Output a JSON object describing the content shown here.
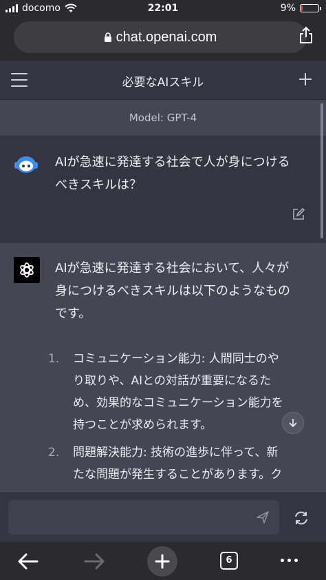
{
  "status_bar": {
    "carrier": "docomo",
    "time": "22:01",
    "battery_text": "9%",
    "battery_level": 0.09
  },
  "browser": {
    "url": "chat.openai.com"
  },
  "chat_header": {
    "title": "必要なAIスキル"
  },
  "model_label": "Model: GPT-4",
  "user_message": {
    "line1": "AIが急速に発達する社会で人が身につける",
    "line2": "べきスキルは？"
  },
  "assistant_message": {
    "intro_lines": [
      "AIが急速に発達する社会において、人々が",
      "身につけるべきスキルは以下のようなもの",
      "です。"
    ],
    "items": [
      {
        "number": "1.",
        "lines": [
          "コミュニケーション能力: 人間同士のや",
          "り取りや、AIとの対話が重要になるた",
          "め、効果的なコミュニケーション能力を",
          "持つことが求められます。"
        ]
      },
      {
        "number": "2.",
        "lines": [
          "問題解決能力: 技術の進歩に伴って、新",
          "たな問題が発生することがあります。ク"
        ]
      }
    ]
  },
  "composer": {
    "placeholder": ""
  },
  "bottom_nav": {
    "tab_count": "6"
  },
  "colors": {
    "background": "#202123",
    "header": "#343541",
    "assistant_bg": "#444654",
    "battery_low": "#e74c3c"
  }
}
